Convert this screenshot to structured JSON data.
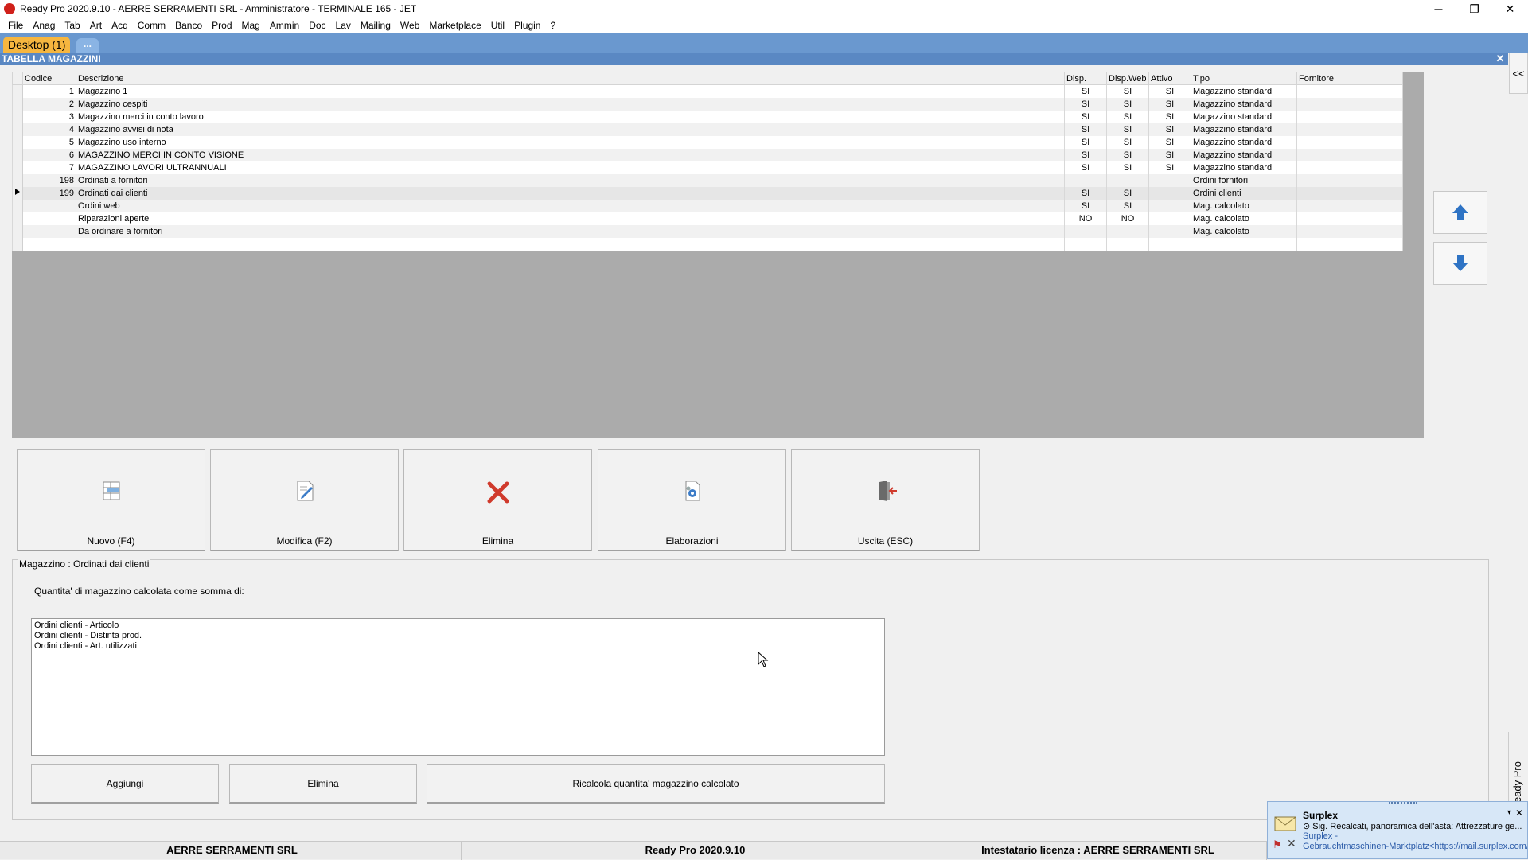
{
  "window": {
    "title": "Ready Pro 2020.9.10 - AERRE SERRAMENTI SRL - Amministratore - TERMINALE 165 - JET",
    "minimize": "─",
    "restore": "❐",
    "close": "✕"
  },
  "menu": [
    "File",
    "Anag",
    "Tab",
    "Art",
    "Acq",
    "Comm",
    "Banco",
    "Prod",
    "Mag",
    "Ammin",
    "Doc",
    "Lav",
    "Mailing",
    "Web",
    "Marketplace",
    "Util",
    "Plugin",
    "?"
  ],
  "tabs": {
    "desktop": "Desktop (1)",
    "more": "..."
  },
  "panel_title": "TABELLA MAGAZZINI",
  "panel_close": "✕",
  "side_collapse": "<<",
  "grid": {
    "columns": [
      "Codice",
      "Descrizione",
      "Disp.",
      "Disp.Web",
      "Attivo",
      "Tipo",
      "Fornitore"
    ],
    "rows": [
      {
        "codice": "1",
        "descrizione": "Magazzino 1",
        "disp": "SI",
        "dispweb": "SI",
        "attivo": "SI",
        "tipo": "Magazzino standard",
        "fornitore": ""
      },
      {
        "codice": "2",
        "descrizione": "Magazzino cespiti",
        "disp": "SI",
        "dispweb": "SI",
        "attivo": "SI",
        "tipo": "Magazzino standard",
        "fornitore": ""
      },
      {
        "codice": "3",
        "descrizione": "Magazzino merci in conto lavoro",
        "disp": "SI",
        "dispweb": "SI",
        "attivo": "SI",
        "tipo": "Magazzino standard",
        "fornitore": ""
      },
      {
        "codice": "4",
        "descrizione": "Magazzino avvisi di nota",
        "disp": "SI",
        "dispweb": "SI",
        "attivo": "SI",
        "tipo": "Magazzino standard",
        "fornitore": ""
      },
      {
        "codice": "5",
        "descrizione": "Magazzino uso interno",
        "disp": "SI",
        "dispweb": "SI",
        "attivo": "SI",
        "tipo": "Magazzino standard",
        "fornitore": ""
      },
      {
        "codice": "6",
        "descrizione": "MAGAZZINO MERCI IN CONTO VISIONE",
        "disp": "SI",
        "dispweb": "SI",
        "attivo": "SI",
        "tipo": "Magazzino standard",
        "fornitore": ""
      },
      {
        "codice": "7",
        "descrizione": "MAGAZZINO LAVORI ULTRANNUALI",
        "disp": "SI",
        "dispweb": "SI",
        "attivo": "SI",
        "tipo": "Magazzino standard",
        "fornitore": ""
      },
      {
        "codice": "198",
        "descrizione": "Ordinati a fornitori",
        "disp": "",
        "dispweb": "",
        "attivo": "",
        "tipo": "Ordini fornitori",
        "fornitore": ""
      },
      {
        "codice": "199",
        "descrizione": "Ordinati dai clienti",
        "disp": "SI",
        "dispweb": "SI",
        "attivo": "",
        "tipo": "Ordini clienti",
        "fornitore": ""
      },
      {
        "codice": "",
        "descrizione": "Ordini web",
        "disp": "SI",
        "dispweb": "SI",
        "attivo": "",
        "tipo": "Mag. calcolato",
        "fornitore": ""
      },
      {
        "codice": "",
        "descrizione": "Riparazioni aperte",
        "disp": "NO",
        "dispweb": "NO",
        "attivo": "",
        "tipo": "Mag. calcolato",
        "fornitore": ""
      },
      {
        "codice": "",
        "descrizione": "Da ordinare a fornitori",
        "disp": "",
        "dispweb": "",
        "attivo": "",
        "tipo": "Mag. calcolato",
        "fornitore": ""
      }
    ],
    "selected_row": 8
  },
  "actions": {
    "nuovo": "Nuovo (F4)",
    "modifica": "Modifica (F2)",
    "elimina": "Elimina",
    "elaborazioni": "Elaborazioni",
    "uscita": "Uscita (ESC)"
  },
  "detail": {
    "legend": "Magazzino : Ordinati dai clienti",
    "calc_label": "Quantita' di magazzino calcolata come somma di:",
    "items": [
      "Ordini clienti - Articolo",
      "Ordini clienti - Distinta prod.",
      "Ordini clienti - Art. utilizzati"
    ],
    "buttons": {
      "aggiungi": "Aggiungi",
      "elimina": "Elimina",
      "ricalcola": "Ricalcola quantita' magazzino calcolato"
    }
  },
  "status": {
    "company": "AERRE SERRAMENTI SRL",
    "version": "Ready Pro 2020.9.10",
    "license": "Intestatario licenza : AERRE SERRAMENTI SRL"
  },
  "side_vertical_tab": "nte Ready Pro",
  "notification": {
    "title": "Surplex",
    "line1": "⊙ Sig. Recalcati, panoramica dell'asta: Attrezzature ge...",
    "line2": "Surplex -",
    "line3": "Gebrauchtmaschinen-Marktplatz<https://mail.surplex.com/",
    "dropdown": "▾",
    "close": "✕"
  },
  "colors": {
    "tabstrip": "#6a98cf",
    "panel_title_bg": "#5a88c3",
    "desktop_tab": "#f6b63f",
    "arrow_blue": "#2e73c4",
    "delete_red": "#d03a2c"
  }
}
